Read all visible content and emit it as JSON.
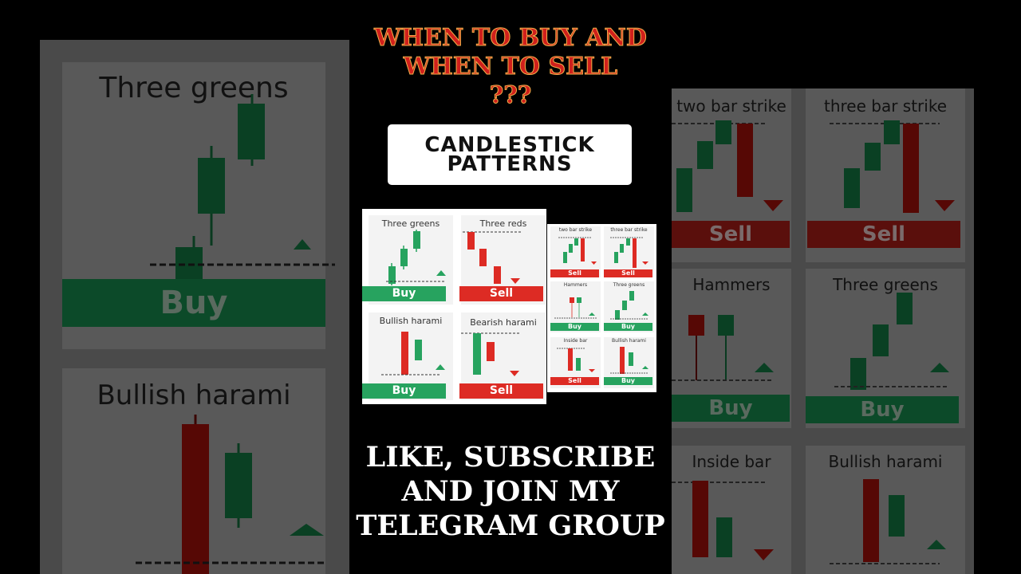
{
  "headline": {
    "line1": "WHEN TO BUY AND",
    "line2": "WHEN TO SELL",
    "line3": "???"
  },
  "badge": {
    "line1": "CANDLESTICK",
    "line2": "PATTERNS"
  },
  "cta": {
    "line1": "LIKE, SUBSCRIBE",
    "line2": "AND JOIN MY",
    "line3": "TELEGRAM GROUP"
  },
  "colors": {
    "buy": "#27a35f",
    "sell": "#dd2b24",
    "headline": "#d0201c",
    "headline_outline": "#f2b04a"
  },
  "large_cheatsheet": [
    {
      "title": "Three greens",
      "signal": "Buy"
    },
    {
      "title": "Three reds",
      "signal": "Sell"
    },
    {
      "title": "Bullish harami",
      "signal": "Buy"
    },
    {
      "title": "Bearish harami",
      "signal": "Sell"
    }
  ],
  "small_cheatsheet": [
    {
      "title": "two bar strike",
      "signal": "Sell"
    },
    {
      "title": "three bar strike",
      "signal": "Sell"
    },
    {
      "title": "Hammers",
      "signal": "Buy"
    },
    {
      "title": "Three greens",
      "signal": "Buy"
    },
    {
      "title": "Inside bar",
      "signal": "Sell"
    },
    {
      "title": "Bullish harami",
      "signal": "Buy"
    }
  ],
  "background_left": [
    {
      "title": "Three greens",
      "signal": "Buy"
    },
    {
      "title": "Bullish harami",
      "signal": ""
    }
  ],
  "background_right": [
    {
      "title": "two bar strike",
      "signal": "Sell"
    },
    {
      "title": "three bar strike",
      "signal": "Sell"
    },
    {
      "title": "Hammers",
      "signal": "Buy"
    },
    {
      "title": "Three greens",
      "signal": "Buy"
    },
    {
      "title": "Inside bar",
      "signal": ""
    },
    {
      "title": "Bullish harami",
      "signal": ""
    }
  ]
}
